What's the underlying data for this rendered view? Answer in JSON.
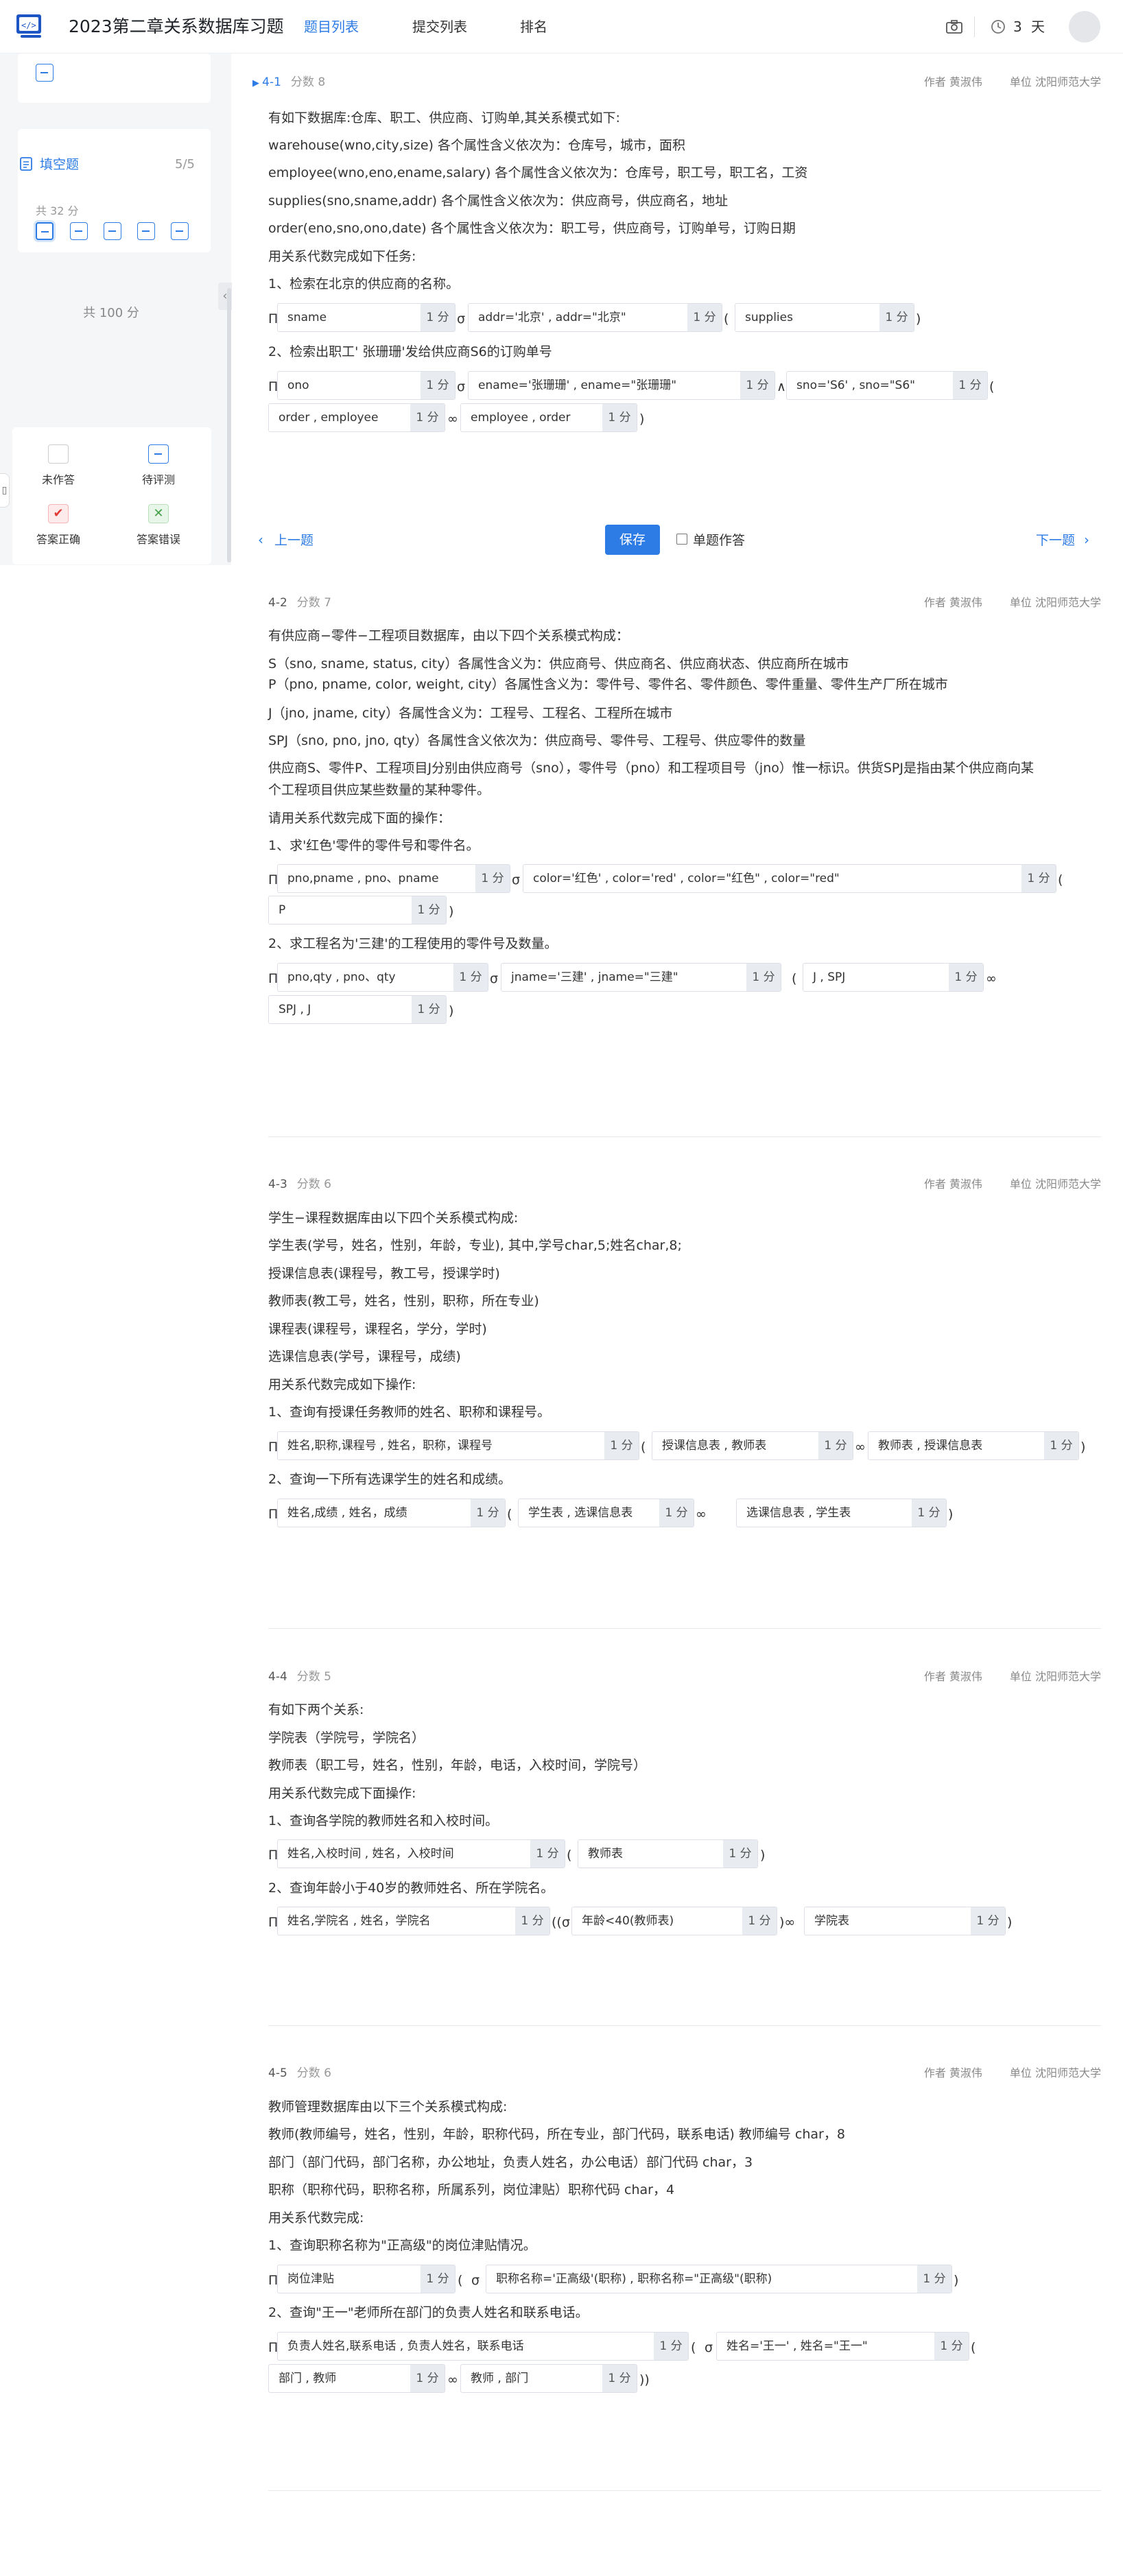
{
  "header": {
    "title": "2023第二章关系数据库习题",
    "tabs": [
      {
        "label": "题目列表"
      },
      {
        "label": "提交列表"
      },
      {
        "label": "排名"
      }
    ],
    "days_value": "3",
    "days_unit": "天"
  },
  "sidebar": {
    "section_title": "填空题",
    "section_count": "5/5",
    "total_score": "共 32 分",
    "grand_total": "共 100 分",
    "legend": {
      "unanswered": "未作答",
      "pending": "待评测",
      "correct": "答案正确",
      "wrong": "答案错误"
    }
  },
  "nav": {
    "prev": "上一题",
    "save": "保存",
    "single": "单题作答",
    "next": "下一题"
  },
  "questions": [
    {
      "id": "4-1",
      "score": "分数 8",
      "author": "作者 黄淑伟",
      "unit": "单位 沈阳师范大学",
      "lines": [
        "有如下数据库:仓库、职工、供应商、订购单,其关系模式如下:",
        "warehouse(wno,city,size) 各个属性含义依次为：仓库号，城市，面积",
        "employee(wno,eno,ename,salary) 各个属性含义依次为：仓库号，职工号，职工名，工资",
        "supplies(sno,sname,addr) 各个属性含义依次为：供应商号，供应商名，地址",
        "order(eno,sno,ono,date) 各个属性含义依次为：职工号，供应商号，订购单号，订购日期",
        "用关系代数完成如下任务:",
        "1、检索在北京的供应商的名称。"
      ],
      "blanks": [
        "sname",
        "addr='北京' , addr=\"北京\"",
        "supplies"
      ],
      "line2": "2、检索出职工' 张珊珊'发给供应商S6的订购单号",
      "blanks2": [
        "ono",
        "ename='张珊珊' , ename=\"张珊珊\"",
        "sno='S6' , sno=\"S6\"",
        "order , employee",
        "employee , order"
      ]
    },
    {
      "id": "4-2",
      "score": "分数 7",
      "author": "作者 黄淑伟",
      "unit": "单位 沈阳师范大学",
      "lines": [
        "有供应商−零件−工程项目数据库，由以下四个关系模式构成：",
        "S（sno, sname, status, city）各属性含义为：供应商号、供应商名、供应商状态、供应商所在城市",
        "P（pno, pname, color, weight, city）各属性含义为：零件号、零件名、零件颜色、零件重量、零件生产厂所在城市",
        "J（jno, jname, city）各属性含义为：工程号、工程名、工程所在城市",
        "SPJ（sno, pno, jno, qty）各属性含义依次为：供应商号、零件号、工程号、供应零件的数量",
        "供应商S、零件P、工程项目J分别由供应商号（sno），零件号（pno）和工程项目号（jno）惟一标识。供货SPJ是指由某个供应商向某",
        "个工程项目供应某些数量的某种零件。",
        "请用关系代数完成下面的操作：",
        "1、求'红色'零件的零件号和零件名。"
      ],
      "blanks": [
        "pno,pname , pno、pname",
        "color='红色' , color='red' , color=\"红色\" , color=\"red\"",
        "P"
      ],
      "line2": "2、求工程名为'三建'的工程使用的零件号及数量。",
      "blanks2": [
        "pno,qty , pno、qty",
        "jname='三建' , jname=\"三建\"",
        "J , SPJ",
        "SPJ , J"
      ]
    },
    {
      "id": "4-3",
      "score": "分数 6",
      "author": "作者 黄淑伟",
      "unit": "单位 沈阳师范大学",
      "lines": [
        "学生−课程数据库由以下四个关系模式构成:",
        "学生表(学号，姓名，性别，年龄，专业), 其中,学号char,5;姓名char,8;",
        "授课信息表(课程号，教工号，授课学时)",
        "教师表(教工号，姓名，性别，职称，所在专业)",
        "课程表(课程号，课程名，学分，学时)",
        "选课信息表(学号，课程号，成绩)",
        "用关系代数完成如下操作:",
        "1、查询有授课任务教师的姓名、职称和课程号。"
      ],
      "blanks": [
        "姓名,职称,课程号 , 姓名，职称，课程号",
        "授课信息表 , 教师表",
        "教师表 , 授课信息表"
      ],
      "line2": "2、查询一下所有选课学生的姓名和成绩。",
      "blanks2": [
        "姓名,成绩 , 姓名，成绩",
        "学生表 , 选课信息表",
        "选课信息表 , 学生表"
      ]
    },
    {
      "id": "4-4",
      "score": "分数 5",
      "author": "作者 黄淑伟",
      "unit": "单位 沈阳师范大学",
      "lines": [
        "有如下两个关系:",
        "学院表（学院号，学院名）",
        "教师表（职工号，姓名，性别，年龄，电话，入校时间，学院号）",
        "用关系代数完成下面操作:",
        "1、查询各学院的教师姓名和入校时间。"
      ],
      "blanks": [
        "姓名,入校时间 , 姓名，入校时间",
        "教师表"
      ],
      "line2": "2、查询年龄小于40岁的教师姓名、所在学院名。",
      "blanks2": [
        "姓名,学院名 , 姓名，学院名",
        "年龄<40(教师表)",
        "学院表"
      ]
    },
    {
      "id": "4-5",
      "score": "分数 6",
      "author": "作者 黄淑伟",
      "unit": "单位 沈阳师范大学",
      "lines": [
        "教师管理数据库由以下三个关系模式构成:",
        "教师(教师编号，姓名，性别，年龄，职称代码，所在专业，部门代码，联系电话) 教师编号 char，8",
        "部门（部门代码，部门名称，办公地址，负责人姓名，办公电话）部门代码 char，3",
        "职称（职称代码，职称名称，所属系列，岗位津贴）职称代码 char，4",
        "用关系代数完成:",
        "1、查询职称名称为\"正高级\"的岗位津贴情况。"
      ],
      "blanks": [
        "岗位津贴",
        "职称名称='正高级'(职称) , 职称名称=\"正高级\"(职称)"
      ],
      "line2": "2、查询\"王一\"老师所在部门的负责人姓名和联系电话。",
      "blanks2": [
        "负责人姓名,联系电话 , 负责人姓名，联系电话",
        "姓名='王一' , 姓名=\"王一\"",
        "部门 , 教师",
        "教师 , 部门"
      ]
    }
  ],
  "point_label": "1 分",
  "symbols": {
    "pi": "Π",
    "sigma": "σ",
    "join": "∞",
    "and": "∧",
    "lp": "(",
    "rp": ")",
    "lpp": "((σ",
    "rpp": "))",
    "rps": ")∞"
  },
  "colors": {
    "accent": "#2d7be5",
    "correct": "#e53935",
    "wrong": "#43a047"
  }
}
